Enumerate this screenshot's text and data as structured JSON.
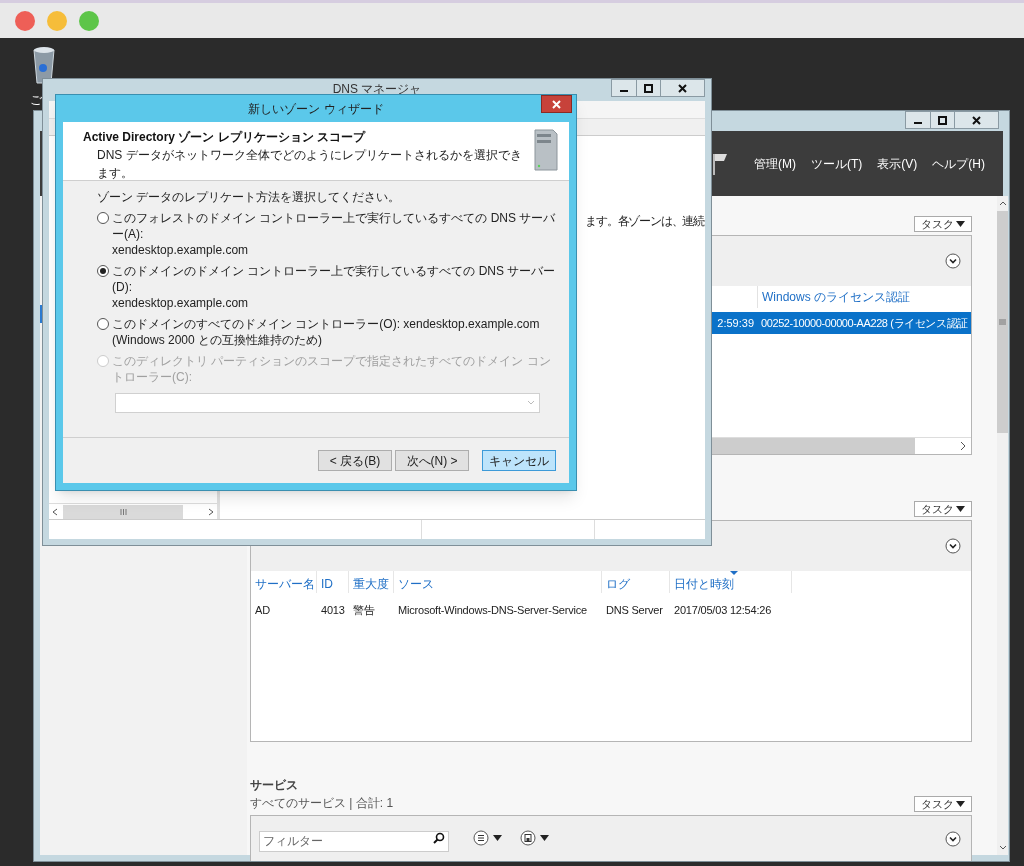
{
  "desktop": {
    "icon_label": "ご"
  },
  "server_manager": {
    "menu": [
      "管理(M)",
      "ツール(T)",
      "表示(V)",
      "ヘルプ(H)"
    ],
    "panels": [
      {
        "task_button": "タスク",
        "columns": [
          {},
          {
            "label": "Windows のライセンス認証"
          }
        ],
        "rows": [
          {
            "cells": [
              "2:59:39",
              "00252-10000-00000-AA228 (ライセンス認証"
            ],
            "selected": true
          }
        ]
      },
      {
        "task_button": "タスク",
        "columns": [
          {
            "label": "サーバー名",
            "sorted": false
          },
          {
            "label": "ID",
            "sorted": false
          },
          {
            "label": "重大度",
            "sorted": false
          },
          {
            "label": "ソース",
            "sorted": false
          },
          {
            "label": "ログ",
            "sorted": false
          },
          {
            "label": "日付と時刻",
            "sorted": true
          }
        ],
        "rows": [
          {
            "cells": [
              "AD",
              "4013",
              "警告",
              "Microsoft-Windows-DNS-Server-Service",
              "DNS Server",
              "2017/05/03 12:54:26"
            ],
            "selected": false
          }
        ]
      }
    ],
    "services": {
      "title": "サービス",
      "subtitle": "すべてのサービス | 合計: 1",
      "task_button": "タスク",
      "filter_placeholder": "フィルター"
    }
  },
  "dns_manager": {
    "title": "DNS マネージャ",
    "detail_text": "ます。各ゾーンは、連続"
  },
  "dialog": {
    "title": "新しいゾーン ウィザード",
    "heading": "Active Directory ゾーン レプリケーション スコープ",
    "subheading": "DNS データがネットワーク全体でどのようにレプリケートされるかを選択できます。",
    "prompt": "ゾーン データのレプリケート方法を選択してください。",
    "options": [
      {
        "label": "このフォレストのドメイン コントローラー上で実行しているすべての DNS サーバー(A):",
        "detail": "xendesktop.example.com",
        "selected": false,
        "disabled": false
      },
      {
        "label": "このドメインのドメイン コントローラー上で実行しているすべての DNS サーバー(D):",
        "detail": "xendesktop.example.com",
        "selected": true,
        "disabled": false
      },
      {
        "label": "このドメインのすべてのドメイン コントローラー(O): xendesktop.example.com",
        "detail": "(Windows 2000 との互換性維持のため)",
        "selected": false,
        "disabled": false
      },
      {
        "label": "このディレクトリ パーティションのスコープで指定されたすべてのドメイン コントローラー(C):",
        "selected": false,
        "disabled": true
      }
    ],
    "partition_combo": {
      "disabled": true
    },
    "buttons": [
      {
        "label": "< 戻る(B)",
        "highlighted": false
      },
      {
        "label": "次へ(N) >",
        "highlighted": false
      },
      {
        "label": "キャンセル",
        "highlighted": true
      }
    ]
  }
}
